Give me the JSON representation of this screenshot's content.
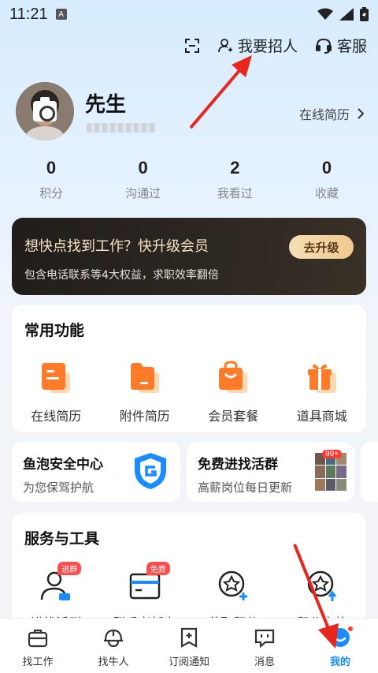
{
  "status_bar": {
    "time": "11:21",
    "badge": "A"
  },
  "header": {
    "scan_icon": "scan-icon",
    "recruit_label": "我要招人",
    "service_label": "客服"
  },
  "profile": {
    "name": "先生",
    "resume_link": "在线简历"
  },
  "stats": [
    {
      "value": "0",
      "label": "积分"
    },
    {
      "value": "0",
      "label": "沟通过"
    },
    {
      "value": "2",
      "label": "我看过"
    },
    {
      "value": "0",
      "label": "收藏"
    }
  ],
  "vip_banner": {
    "title": "想快点找到工作？快升级会员",
    "subtitle": "包含电话联系等4大权益，求职效率翻倍",
    "button": "去升级"
  },
  "common_functions": {
    "title": "常用功能",
    "items": [
      {
        "label": "在线简历",
        "icon": "resume-icon"
      },
      {
        "label": "附件简历",
        "icon": "folder-icon"
      },
      {
        "label": "会员套餐",
        "icon": "bag-icon"
      },
      {
        "label": "道具商城",
        "icon": "gift-icon"
      }
    ]
  },
  "safety_card": {
    "title": "鱼泡安全中心",
    "subtitle": "为您保驾护航"
  },
  "group_card": {
    "title": "免费进找活群",
    "subtitle": "高薪岗位每日更新",
    "badge": "99+"
  },
  "services": {
    "title": "服务与工具",
    "items": [
      {
        "label": "进找活群",
        "icon": "group-person-icon",
        "tag": "进群"
      },
      {
        "label": "联系老板卡",
        "icon": "card-icon",
        "tag": "免费"
      },
      {
        "label": "获取积分",
        "icon": "star-badge-icon",
        "tag": ""
      },
      {
        "label": "积分充值",
        "icon": "star-recharge-icon",
        "tag": ""
      }
    ]
  },
  "bottom_nav": [
    {
      "label": "找工作",
      "icon": "briefcase-icon",
      "active": false
    },
    {
      "label": "找牛人",
      "icon": "helmet-icon",
      "active": false
    },
    {
      "label": "订阅通知",
      "icon": "subscribe-icon",
      "active": false
    },
    {
      "label": "消息",
      "icon": "message-icon",
      "active": false
    },
    {
      "label": "我的",
      "icon": "profile-icon",
      "active": true
    }
  ],
  "colors": {
    "accent": "#1a8cff",
    "orange": "#ff7a29",
    "annotation_arrow": "#e8261d"
  }
}
